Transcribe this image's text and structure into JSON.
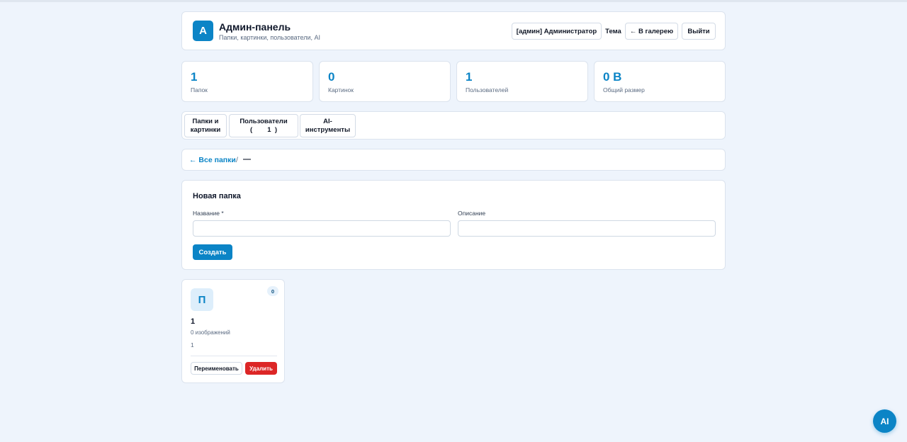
{
  "header": {
    "logo_letter": "A",
    "title": "Админ-панель",
    "subtitle": "Папки, картинки, пользователи, AI",
    "user_label": "[админ] Администратор",
    "theme_label": "Тема",
    "gallery_label": "← В галерею",
    "logout_label": "Выйти"
  },
  "stats": [
    {
      "value": "1",
      "label": "Папок"
    },
    {
      "value": "0",
      "label": "Картинок"
    },
    {
      "value": "1",
      "label": "Пользователей"
    },
    {
      "value": "0 B",
      "label": "Общий размер"
    }
  ],
  "tabs": [
    {
      "line1": "Папки и",
      "line2": "картинки"
    },
    {
      "line1": "Пользователи",
      "line2": "(        1  )"
    },
    {
      "line1": "AI-",
      "line2": "инструменты"
    }
  ],
  "breadcrumb": {
    "back_label": "← Все папки",
    "separator": "/",
    "current": "—"
  },
  "new_folder": {
    "title": "Новая папка",
    "name_label": "Название *",
    "name_value": "",
    "description_label": "Описание",
    "description_value": "",
    "create_label": "Создать"
  },
  "folders": [
    {
      "icon_letter": "П",
      "badge": "0",
      "name": "1",
      "count_text": "0 изображений",
      "description": "1",
      "rename_label": "Переименовать",
      "delete_label": "Удалить"
    }
  ],
  "ai_button_label": "AI",
  "colors": {
    "accent": "#0b84c6",
    "danger": "#dc2626",
    "background": "#eef4fc"
  }
}
